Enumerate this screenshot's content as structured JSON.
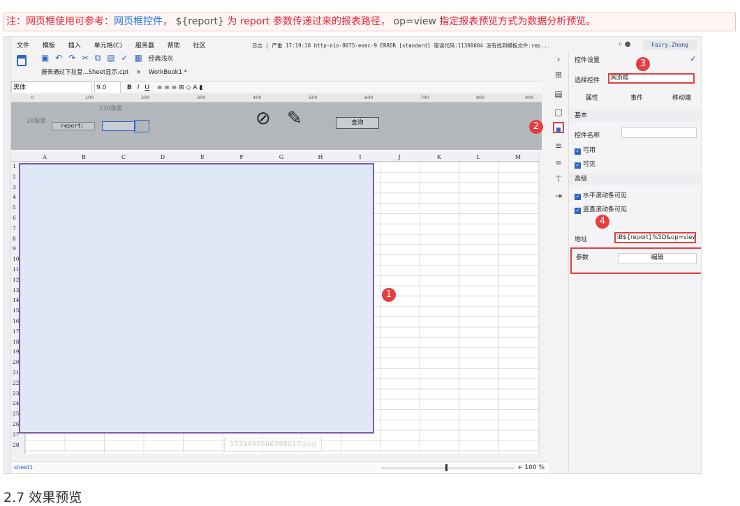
{
  "note": {
    "prefix": "注：网页框使用可参考：",
    "link": "网页框控件",
    "sep": "，",
    "report_var": "${report}",
    "mid": "为 report 参数传递过来的报表路径，",
    "op": "op=view",
    "suffix": "指定报表预览方式为数据分析预览。"
  },
  "menubar": {
    "items": [
      "文件",
      "模板",
      "插入",
      "单元格(C)",
      "服务器",
      "帮助",
      "社区"
    ],
    "log": "日志 | 严重 17:19:10 http-nio-8075-exec-9 ERROR [standard] 错误代码:11300004 没有找到模板文件:rep...",
    "user": "Fairy.Zhang"
  },
  "toolbar": {
    "classic": "经典浅灰",
    "tab1": "报表通过下拉复...Sheet显示.cpt",
    "tab2": "WorkBook1 *"
  },
  "format": {
    "font": "黑体",
    "size": "9.0"
  },
  "ruler": {
    "marks": [
      "0",
      "100",
      "200",
      "300",
      "400",
      "500",
      "600",
      "700",
      "800",
      "900"
    ]
  },
  "param": {
    "px130": "130像素",
    "px26": "26像素",
    "label": "report:",
    "query": "查询"
  },
  "grid": {
    "columns": [
      "A",
      "B",
      "C",
      "D",
      "E",
      "F",
      "G",
      "H",
      "I",
      "J",
      "K",
      "L",
      "M"
    ],
    "rows": [
      "1",
      "2",
      "3",
      "4",
      "5",
      "6",
      "7",
      "8",
      "9",
      "10",
      "11",
      "12",
      "13",
      "14",
      "15",
      "16",
      "17",
      "18",
      "19",
      "20",
      "21",
      "22",
      "23",
      "24",
      "25",
      "26",
      "27",
      "28"
    ]
  },
  "watermark": "1731490686398017.png",
  "status": {
    "sheet": "sheet1",
    "zoom": "+ 100 %"
  },
  "panel": {
    "title": "控件设置",
    "select_label": "选择控件",
    "select_value": "网页框",
    "tabs": [
      "属性",
      "事件",
      "移动端"
    ],
    "basic": "基本",
    "name_label": "控件名称",
    "enabled": "可用",
    "visible": "可见",
    "advanced": "高级",
    "hscroll": "水平滚动条可见",
    "vscroll": "竖直滚动条可见",
    "addr_label": "地址",
    "addr_value": "iB${report}%5D&op=view",
    "param_label": "参数",
    "edit": "编辑"
  },
  "badges": [
    "1",
    "2",
    "3",
    "4"
  ],
  "footer": "2.7 效果预览"
}
